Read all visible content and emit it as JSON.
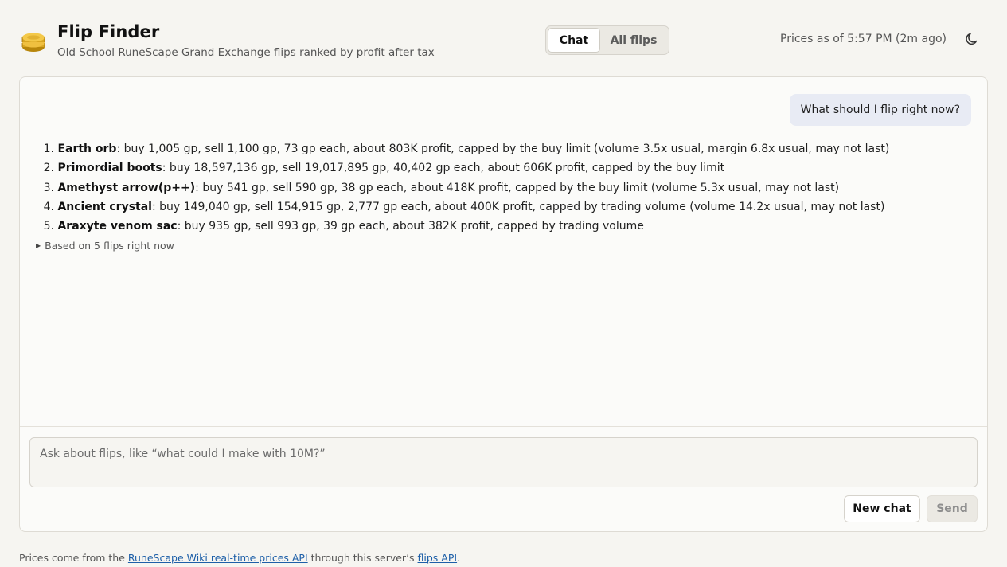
{
  "header": {
    "title": "Flip Finder",
    "subtitle": "Old School RuneScape Grand Exchange flips ranked by profit after tax",
    "logo_icon": "coin-stack-icon",
    "tabs": [
      {
        "label": "Chat",
        "active": true
      },
      {
        "label": "All flips",
        "active": false
      }
    ],
    "prices_as_of": "Prices as of 5:57 PM (2m ago)",
    "theme_icon": "moon-icon"
  },
  "chat": {
    "user_message": "What should I flip right now?",
    "answer": [
      {
        "num": "1.",
        "item": "Earth orb",
        "detail": ": buy 1,005 gp, sell 1,100 gp, 73 gp each, about 803K profit, capped by the buy limit (volume 3.5x usual, margin 6.8x usual, may not last)"
      },
      {
        "num": "2.",
        "item": "Primordial boots",
        "detail": ": buy 18,597,136 gp, sell 19,017,895 gp, 40,402 gp each, about 606K profit, capped by the buy limit"
      },
      {
        "num": "3.",
        "item": "Amethyst arrow(p++)",
        "detail": ": buy 541 gp, sell 590 gp, 38 gp each, about 418K profit, capped by the buy limit (volume 5.3x usual, may not last)"
      },
      {
        "num": "4.",
        "item": "Ancient crystal",
        "detail": ": buy 149,040 gp, sell 154,915 gp, 2,777 gp each, about 400K profit, capped by trading volume (volume 14.2x usual, may not last)"
      },
      {
        "num": "5.",
        "item": "Araxyte venom sac",
        "detail": ": buy 935 gp, sell 993 gp, 39 gp each, about 382K profit, capped by trading volume"
      }
    ],
    "details_label": "Based on 5 flips right now",
    "input_placeholder": "Ask about flips, like “what could I make with 10M?”",
    "input_value": "",
    "new_chat_label": "New chat",
    "send_label": "Send"
  },
  "footer": {
    "prefix": "Prices come from the ",
    "link1": "RuneScape Wiki real-time prices API",
    "middle": " through this server’s ",
    "link2": "flips API",
    "suffix": "."
  },
  "colors": {
    "background": "#f6f5f1",
    "user_bubble": "#e8ebf4",
    "link": "#1d5fa8"
  }
}
